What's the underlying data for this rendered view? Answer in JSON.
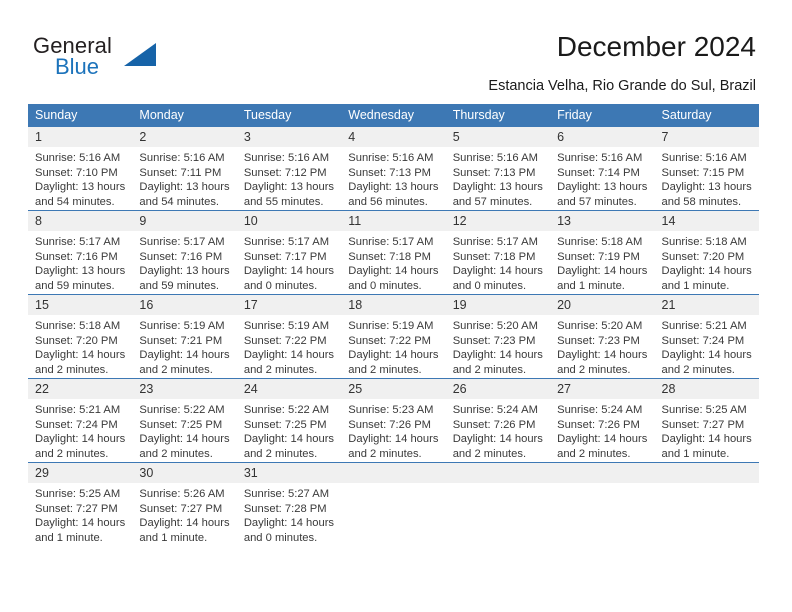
{
  "brand": {
    "name_part1": "General",
    "name_part2": "Blue",
    "logo_icon": "triangle-flag-icon",
    "accent_color": "#1c73bb"
  },
  "header": {
    "title": "December 2024",
    "location": "Estancia Velha, Rio Grande do Sul, Brazil"
  },
  "theme": {
    "header_blue": "#3d78b4",
    "daynum_band": "#f0f0f0",
    "text": "#3a3a3a"
  },
  "calendar": {
    "weekday_headers": [
      "Sunday",
      "Monday",
      "Tuesday",
      "Wednesday",
      "Thursday",
      "Friday",
      "Saturday"
    ],
    "weeks": [
      [
        {
          "day": "1",
          "sunrise": "Sunrise: 5:16 AM",
          "sunset": "Sunset: 7:10 PM",
          "daylight_1": "Daylight: 13 hours",
          "daylight_2": "and 54 minutes."
        },
        {
          "day": "2",
          "sunrise": "Sunrise: 5:16 AM",
          "sunset": "Sunset: 7:11 PM",
          "daylight_1": "Daylight: 13 hours",
          "daylight_2": "and 54 minutes."
        },
        {
          "day": "3",
          "sunrise": "Sunrise: 5:16 AM",
          "sunset": "Sunset: 7:12 PM",
          "daylight_1": "Daylight: 13 hours",
          "daylight_2": "and 55 minutes."
        },
        {
          "day": "4",
          "sunrise": "Sunrise: 5:16 AM",
          "sunset": "Sunset: 7:13 PM",
          "daylight_1": "Daylight: 13 hours",
          "daylight_2": "and 56 minutes."
        },
        {
          "day": "5",
          "sunrise": "Sunrise: 5:16 AM",
          "sunset": "Sunset: 7:13 PM",
          "daylight_1": "Daylight: 13 hours",
          "daylight_2": "and 57 minutes."
        },
        {
          "day": "6",
          "sunrise": "Sunrise: 5:16 AM",
          "sunset": "Sunset: 7:14 PM",
          "daylight_1": "Daylight: 13 hours",
          "daylight_2": "and 57 minutes."
        },
        {
          "day": "7",
          "sunrise": "Sunrise: 5:16 AM",
          "sunset": "Sunset: 7:15 PM",
          "daylight_1": "Daylight: 13 hours",
          "daylight_2": "and 58 minutes."
        }
      ],
      [
        {
          "day": "8",
          "sunrise": "Sunrise: 5:17 AM",
          "sunset": "Sunset: 7:16 PM",
          "daylight_1": "Daylight: 13 hours",
          "daylight_2": "and 59 minutes."
        },
        {
          "day": "9",
          "sunrise": "Sunrise: 5:17 AM",
          "sunset": "Sunset: 7:16 PM",
          "daylight_1": "Daylight: 13 hours",
          "daylight_2": "and 59 minutes."
        },
        {
          "day": "10",
          "sunrise": "Sunrise: 5:17 AM",
          "sunset": "Sunset: 7:17 PM",
          "daylight_1": "Daylight: 14 hours",
          "daylight_2": "and 0 minutes."
        },
        {
          "day": "11",
          "sunrise": "Sunrise: 5:17 AM",
          "sunset": "Sunset: 7:18 PM",
          "daylight_1": "Daylight: 14 hours",
          "daylight_2": "and 0 minutes."
        },
        {
          "day": "12",
          "sunrise": "Sunrise: 5:17 AM",
          "sunset": "Sunset: 7:18 PM",
          "daylight_1": "Daylight: 14 hours",
          "daylight_2": "and 0 minutes."
        },
        {
          "day": "13",
          "sunrise": "Sunrise: 5:18 AM",
          "sunset": "Sunset: 7:19 PM",
          "daylight_1": "Daylight: 14 hours",
          "daylight_2": "and 1 minute."
        },
        {
          "day": "14",
          "sunrise": "Sunrise: 5:18 AM",
          "sunset": "Sunset: 7:20 PM",
          "daylight_1": "Daylight: 14 hours",
          "daylight_2": "and 1 minute."
        }
      ],
      [
        {
          "day": "15",
          "sunrise": "Sunrise: 5:18 AM",
          "sunset": "Sunset: 7:20 PM",
          "daylight_1": "Daylight: 14 hours",
          "daylight_2": "and 2 minutes."
        },
        {
          "day": "16",
          "sunrise": "Sunrise: 5:19 AM",
          "sunset": "Sunset: 7:21 PM",
          "daylight_1": "Daylight: 14 hours",
          "daylight_2": "and 2 minutes."
        },
        {
          "day": "17",
          "sunrise": "Sunrise: 5:19 AM",
          "sunset": "Sunset: 7:22 PM",
          "daylight_1": "Daylight: 14 hours",
          "daylight_2": "and 2 minutes."
        },
        {
          "day": "18",
          "sunrise": "Sunrise: 5:19 AM",
          "sunset": "Sunset: 7:22 PM",
          "daylight_1": "Daylight: 14 hours",
          "daylight_2": "and 2 minutes."
        },
        {
          "day": "19",
          "sunrise": "Sunrise: 5:20 AM",
          "sunset": "Sunset: 7:23 PM",
          "daylight_1": "Daylight: 14 hours",
          "daylight_2": "and 2 minutes."
        },
        {
          "day": "20",
          "sunrise": "Sunrise: 5:20 AM",
          "sunset": "Sunset: 7:23 PM",
          "daylight_1": "Daylight: 14 hours",
          "daylight_2": "and 2 minutes."
        },
        {
          "day": "21",
          "sunrise": "Sunrise: 5:21 AM",
          "sunset": "Sunset: 7:24 PM",
          "daylight_1": "Daylight: 14 hours",
          "daylight_2": "and 2 minutes."
        }
      ],
      [
        {
          "day": "22",
          "sunrise": "Sunrise: 5:21 AM",
          "sunset": "Sunset: 7:24 PM",
          "daylight_1": "Daylight: 14 hours",
          "daylight_2": "and 2 minutes."
        },
        {
          "day": "23",
          "sunrise": "Sunrise: 5:22 AM",
          "sunset": "Sunset: 7:25 PM",
          "daylight_1": "Daylight: 14 hours",
          "daylight_2": "and 2 minutes."
        },
        {
          "day": "24",
          "sunrise": "Sunrise: 5:22 AM",
          "sunset": "Sunset: 7:25 PM",
          "daylight_1": "Daylight: 14 hours",
          "daylight_2": "and 2 minutes."
        },
        {
          "day": "25",
          "sunrise": "Sunrise: 5:23 AM",
          "sunset": "Sunset: 7:26 PM",
          "daylight_1": "Daylight: 14 hours",
          "daylight_2": "and 2 minutes."
        },
        {
          "day": "26",
          "sunrise": "Sunrise: 5:24 AM",
          "sunset": "Sunset: 7:26 PM",
          "daylight_1": "Daylight: 14 hours",
          "daylight_2": "and 2 minutes."
        },
        {
          "day": "27",
          "sunrise": "Sunrise: 5:24 AM",
          "sunset": "Sunset: 7:26 PM",
          "daylight_1": "Daylight: 14 hours",
          "daylight_2": "and 2 minutes."
        },
        {
          "day": "28",
          "sunrise": "Sunrise: 5:25 AM",
          "sunset": "Sunset: 7:27 PM",
          "daylight_1": "Daylight: 14 hours",
          "daylight_2": "and 1 minute."
        }
      ],
      [
        {
          "day": "29",
          "sunrise": "Sunrise: 5:25 AM",
          "sunset": "Sunset: 7:27 PM",
          "daylight_1": "Daylight: 14 hours",
          "daylight_2": "and 1 minute."
        },
        {
          "day": "30",
          "sunrise": "Sunrise: 5:26 AM",
          "sunset": "Sunset: 7:27 PM",
          "daylight_1": "Daylight: 14 hours",
          "daylight_2": "and 1 minute."
        },
        {
          "day": "31",
          "sunrise": "Sunrise: 5:27 AM",
          "sunset": "Sunset: 7:28 PM",
          "daylight_1": "Daylight: 14 hours",
          "daylight_2": "and 0 minutes."
        },
        {
          "day": "",
          "sunrise": "",
          "sunset": "",
          "daylight_1": "",
          "daylight_2": ""
        },
        {
          "day": "",
          "sunrise": "",
          "sunset": "",
          "daylight_1": "",
          "daylight_2": ""
        },
        {
          "day": "",
          "sunrise": "",
          "sunset": "",
          "daylight_1": "",
          "daylight_2": ""
        },
        {
          "day": "",
          "sunrise": "",
          "sunset": "",
          "daylight_1": "",
          "daylight_2": ""
        }
      ]
    ]
  }
}
